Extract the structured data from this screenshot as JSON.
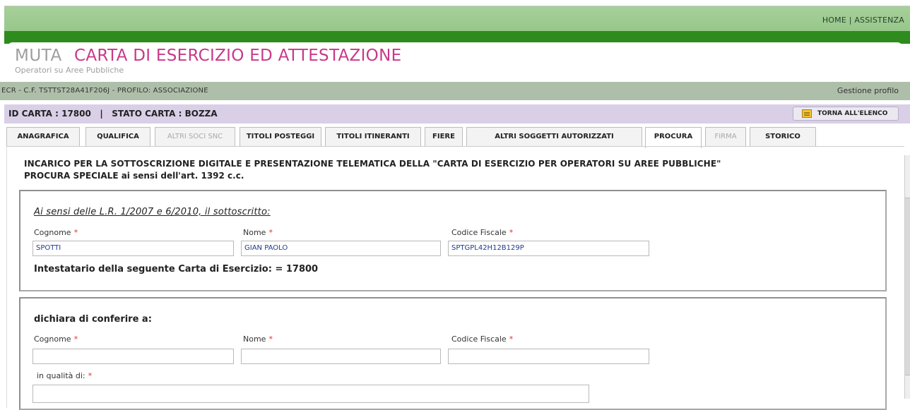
{
  "top_links": {
    "home": "HOME",
    "separator": "|",
    "assistenza": "ASSISTENZA"
  },
  "title": {
    "muta": "MUTA",
    "main": "CARTA DI ESERCIZIO ED ATTESTAZIONE",
    "subtitle": "Operatori su Aree Pubbliche"
  },
  "breadcrumb": {
    "left": "ECR - C.F. TSTTST28A41F206J - PROFILO: ASSOCIAZIONE",
    "right": "Gestione profilo"
  },
  "card_bar": {
    "info": "ID CARTA : 17800   |   STATO CARTA : BOZZA",
    "back_button": "TORNA ALL'ELENCO"
  },
  "tabs": [
    {
      "label": "ANAGRAFICA",
      "state": "normal"
    },
    {
      "label": "QUALIFICA",
      "state": "normal"
    },
    {
      "label": "ALTRI SOCI SNC",
      "state": "disabled"
    },
    {
      "label": "TITOLI POSTEGGI",
      "state": "normal"
    },
    {
      "label": "TITOLI ITINERANTI",
      "state": "normal"
    },
    {
      "label": "FIERE",
      "state": "normal"
    },
    {
      "label": "ALTRI SOGGETTI AUTORIZZATI",
      "state": "normal"
    },
    {
      "label": "PROCURA",
      "state": "active"
    },
    {
      "label": "FIRMA",
      "state": "disabled"
    },
    {
      "label": "STORICO",
      "state": "normal"
    }
  ],
  "content": {
    "heading": "INCARICO PER LA SOTTOSCRIZIONE DIGITALE E PRESENTAZIONE TELEMATICA DELLA \"CARTA DI ESERCIZIO PER OPERATORI SU AREE PUBBLICHE\"",
    "heading2": "PROCURA SPECIALE ai sensi dell'art. 1392 c.c.",
    "section1": {
      "legal": "Ai sensi delle L.R. 1/2007 e 6/2010, il sottoscritto:",
      "cognome_label": "Cognome",
      "nome_label": "Nome",
      "cf_label": "Codice Fiscale",
      "required_mark": "*",
      "cognome_value": "SPOTTI",
      "nome_value": "GIAN PAOLO",
      "cf_value": "SPTGPL42H12B129P",
      "intestatario": "Intestatario della seguente Carta di Esercizio: = 17800"
    },
    "section2": {
      "declare": "dichiara di conferire a:",
      "cognome_label": "Cognome",
      "nome_label": "Nome",
      "cf_label": "Codice Fiscale",
      "qualita_label": "in qualità di:",
      "required_mark": "*",
      "cognome_value": "",
      "nome_value": "",
      "cf_value": "",
      "qualita_value": ""
    }
  },
  "colors": {
    "title_accent": "#c8398b",
    "required_star": "#e03030",
    "header_green": "#2e8b1e",
    "card_bar": "#d9cfe7"
  }
}
